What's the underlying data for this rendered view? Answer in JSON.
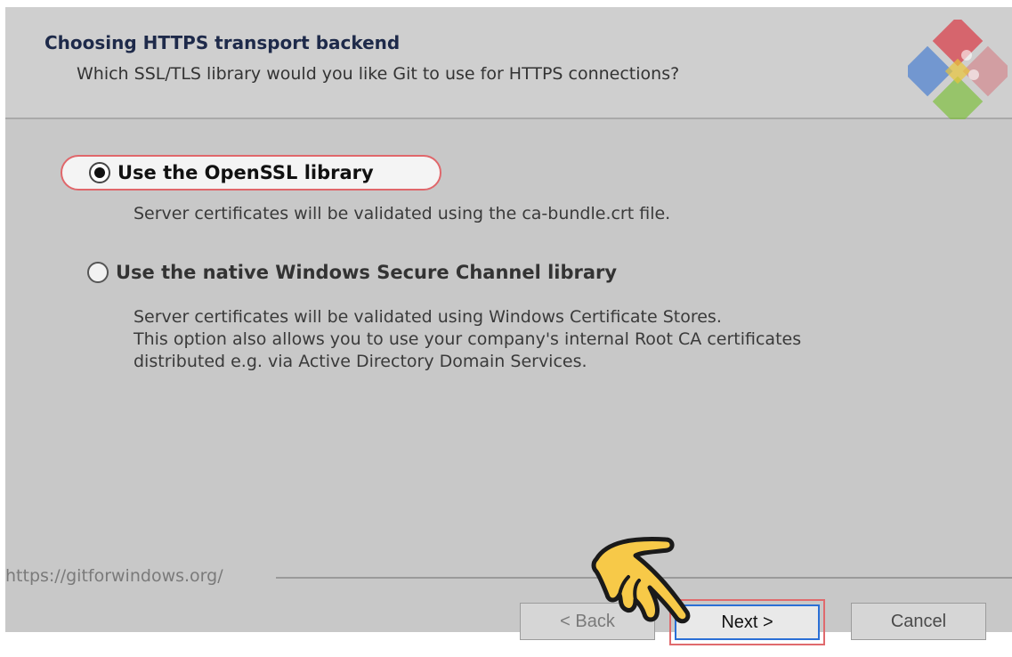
{
  "header": {
    "title": "Choosing HTTPS transport backend",
    "subtitle": "Which SSL/TLS library would you like Git to use for HTTPS connections?"
  },
  "options": [
    {
      "label": "Use the OpenSSL library",
      "selected": true,
      "description": [
        "Server certificates will be validated using the ca-bundle.crt file."
      ]
    },
    {
      "label": "Use the native Windows Secure Channel library",
      "selected": false,
      "description": [
        "Server certificates will be validated using Windows Certificate Stores.",
        "This option also allows you to use your company's internal Root CA certificates",
        "distributed e.g. via Active Directory Domain Services."
      ]
    }
  ],
  "footer": {
    "link": "https://gitforwindows.org/"
  },
  "buttons": {
    "back": "< Back",
    "next": "Next >",
    "cancel": "Cancel"
  },
  "colors": {
    "highlight": "#e0676b",
    "focus": "#2a6fd6",
    "window_bg": "#c8c8c8"
  }
}
